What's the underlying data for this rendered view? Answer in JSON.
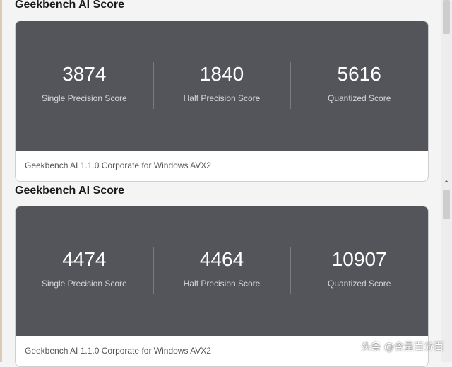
{
  "sections": [
    {
      "title": "Geekbench AI Score",
      "scores": [
        {
          "value": "3874",
          "label": "Single Precision Score"
        },
        {
          "value": "1840",
          "label": "Half Precision Score"
        },
        {
          "value": "5616",
          "label": "Quantized Score"
        }
      ],
      "footer": "Geekbench AI 1.1.0 Corporate for Windows AVX2"
    },
    {
      "title": "Geekbench AI Score",
      "scores": [
        {
          "value": "4474",
          "label": "Single Precision Score"
        },
        {
          "value": "4464",
          "label": "Half Precision Score"
        },
        {
          "value": "10907",
          "label": "Quantized Score"
        }
      ],
      "footer": "Geekbench AI 1.1.0 Corporate for Windows AVX2"
    }
  ],
  "watermark": "头条 @含量百分百",
  "colors": {
    "card_bg": "#54555a",
    "page_bg": "#f4f4f4"
  }
}
